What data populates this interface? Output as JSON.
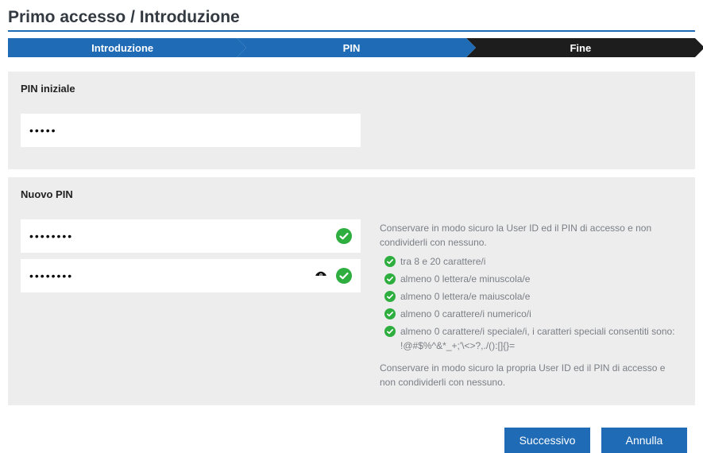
{
  "title": "Primo accesso / Introduzione",
  "stepper": {
    "intro": "Introduzione",
    "pin": "PIN",
    "fine": "Fine"
  },
  "initialPin": {
    "label": "PIN iniziale",
    "value": "•••••"
  },
  "newPin": {
    "label": "Nuovo PIN",
    "value1": "••••••••",
    "value2": "••••••••",
    "intro": "Conservare in modo sicuro la User ID ed il PIN di accesso e non condividerli con nessuno.",
    "rules": [
      "tra 8 e 20 carattere/i",
      "almeno 0 lettera/e minuscola/e",
      "almeno 0 lettera/e maiuscola/e",
      "almeno 0 carattere/i numerico/i",
      "almeno 0 carattere/i speciale/i, i caratteri speciali consentiti sono: !@#$%^&*_+;'\\<>?,./():[]{}="
    ],
    "note": "Conservare in modo sicuro la propria User ID ed il PIN di accesso e non condividerli con nessuno."
  },
  "buttons": {
    "next": "Successivo",
    "cancel": "Annulla"
  }
}
